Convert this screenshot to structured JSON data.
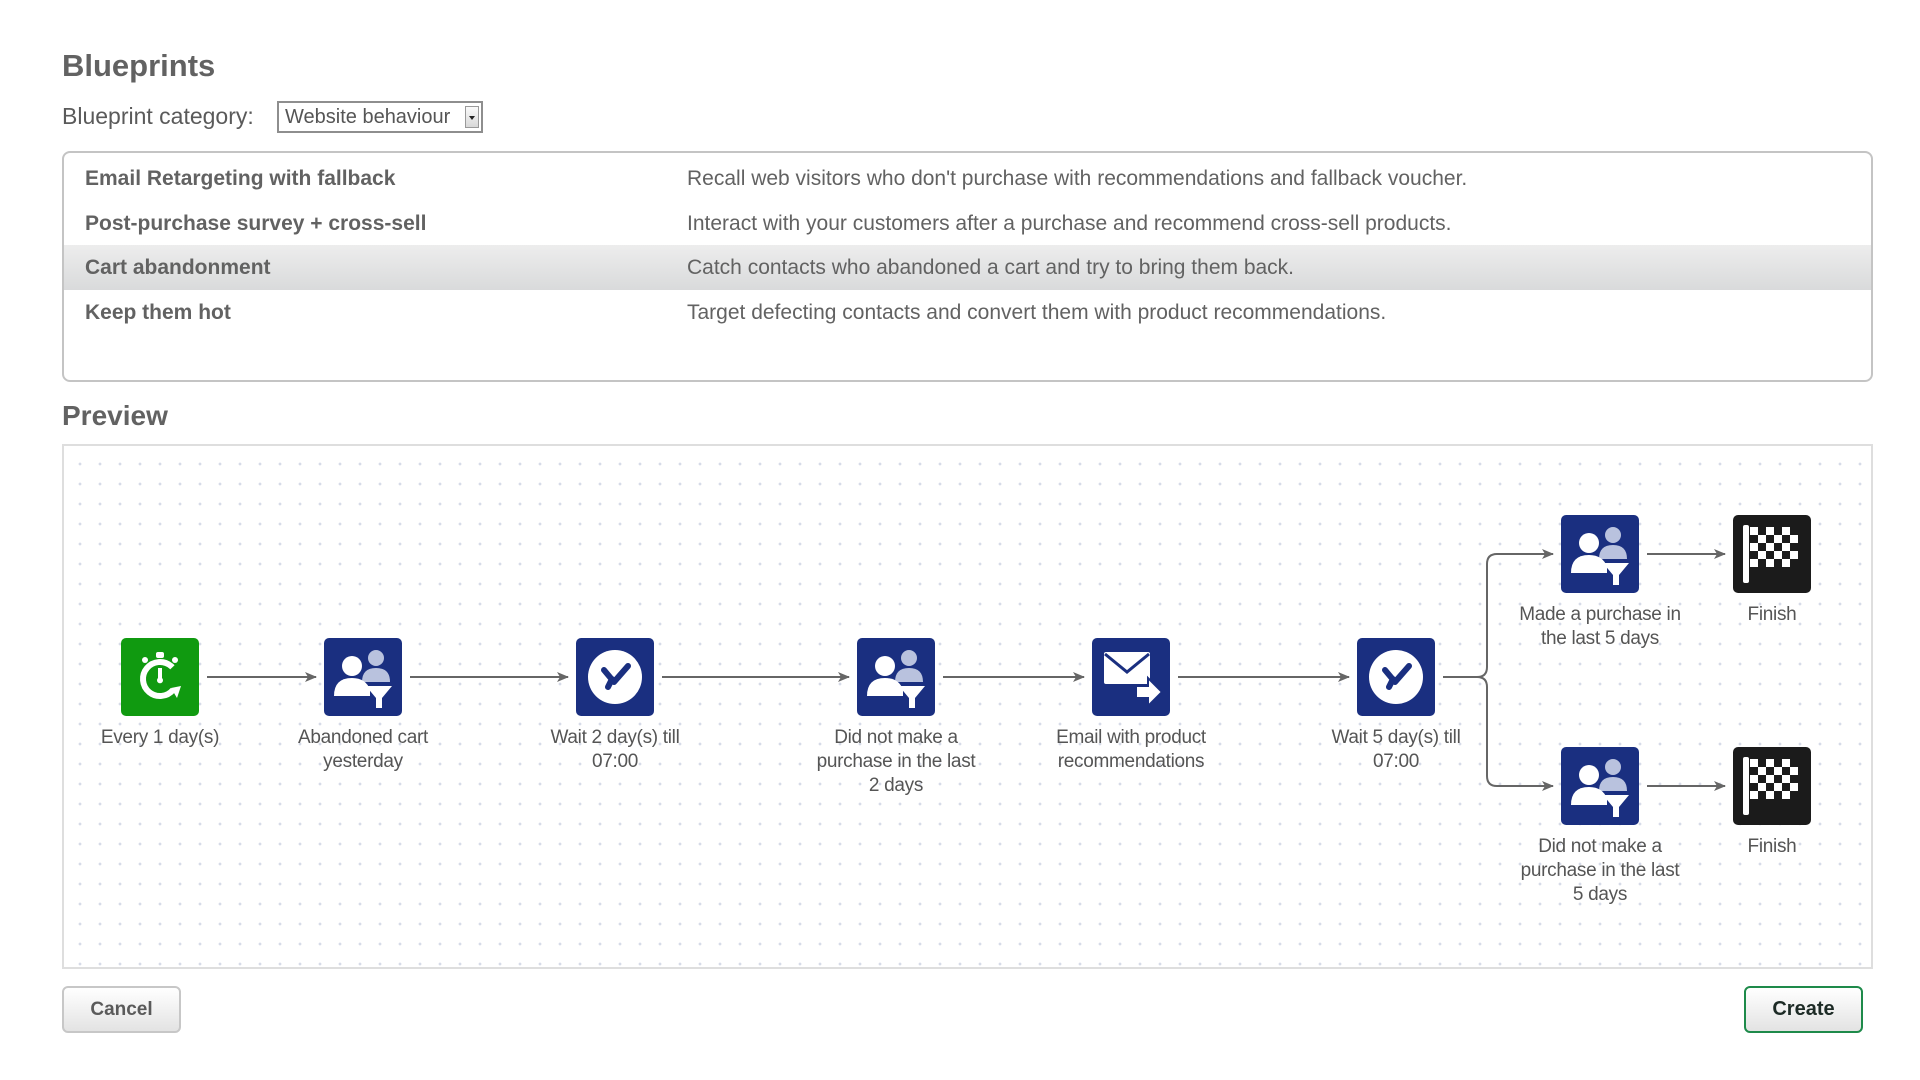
{
  "header": {
    "title": "Blueprints"
  },
  "category": {
    "label": "Blueprint category:",
    "selected": "Website behaviour"
  },
  "blueprints": [
    {
      "name": "Email Retargeting with fallback",
      "description": "Recall web visitors who don't purchase with recommendations and fallback voucher.",
      "selected": false
    },
    {
      "name": "Post-purchase survey + cross-sell",
      "description": "Interact with your customers after a purchase and recommend cross-sell products.",
      "selected": false
    },
    {
      "name": "Cart abandonment",
      "description": "Catch contacts who abandoned a cart and try to bring them back.",
      "selected": true
    },
    {
      "name": "Keep them hot",
      "description": "Target defecting contacts and convert them with product recommendations.",
      "selected": false
    }
  ],
  "preview": {
    "title": "Preview",
    "nodes": [
      {
        "id": "n1",
        "type": "recurring-timer-icon",
        "color": "#109a10",
        "label": [
          "Every 1 day(s)"
        ]
      },
      {
        "id": "n2",
        "type": "segment-filter-icon",
        "color": "#1a2f80",
        "label": [
          "Abandoned cart",
          "yesterday"
        ]
      },
      {
        "id": "n3",
        "type": "clock-icon",
        "color": "#1a2f80",
        "label": [
          "Wait 2 day(s) till",
          "07:00"
        ]
      },
      {
        "id": "n4",
        "type": "segment-filter-icon",
        "color": "#1a2f80",
        "label": [
          "Did not make a",
          "purchase in the last",
          "2 days"
        ]
      },
      {
        "id": "n5",
        "type": "email-send-icon",
        "color": "#1a2f80",
        "label": [
          "Email with product",
          "recommendations"
        ]
      },
      {
        "id": "n6",
        "type": "clock-icon",
        "color": "#1a2f80",
        "label": [
          "Wait 5 day(s) till",
          "07:00"
        ]
      },
      {
        "id": "n7",
        "type": "segment-filter-icon",
        "color": "#1a2f80",
        "label": [
          "Made a purchase in",
          "the last 5 days"
        ]
      },
      {
        "id": "n8",
        "type": "finish-flag-icon",
        "color": "#1b1b1b",
        "label": [
          "Finish"
        ]
      },
      {
        "id": "n9",
        "type": "segment-filter-icon",
        "color": "#1a2f80",
        "label": [
          "Did not make a",
          "purchase in the last",
          "5 days"
        ]
      },
      {
        "id": "n10",
        "type": "finish-flag-icon",
        "color": "#1b1b1b",
        "label": [
          "Finish"
        ]
      }
    ],
    "edges": [
      [
        "n1",
        "n2"
      ],
      [
        "n2",
        "n3"
      ],
      [
        "n3",
        "n4"
      ],
      [
        "n4",
        "n5"
      ],
      [
        "n5",
        "n6"
      ],
      [
        "n6",
        "n7"
      ],
      [
        "n6",
        "n9"
      ],
      [
        "n7",
        "n8"
      ],
      [
        "n9",
        "n10"
      ]
    ]
  },
  "buttons": {
    "cancel": "Cancel",
    "create": "Create"
  },
  "colors": {
    "create_border": "#1e8a4a",
    "arrow": "#666666"
  }
}
